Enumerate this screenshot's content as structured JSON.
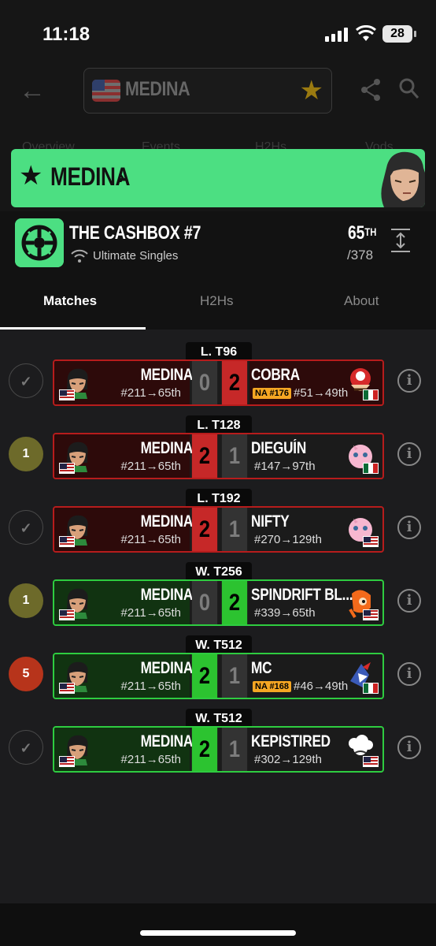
{
  "status": {
    "time": "11:18",
    "battery": "28"
  },
  "header": {
    "search_name": "MEDINA",
    "bg_tabs": [
      "Overview",
      "Events",
      "H2Hs",
      "Vods"
    ]
  },
  "banner": {
    "player": "MEDINA"
  },
  "event": {
    "name": "THE CASHBOX #7",
    "type": "Ultimate Singles",
    "placement": "65",
    "placement_suffix": "TH",
    "entrants": "/378"
  },
  "tabs": [
    "Matches",
    "H2Hs",
    "About"
  ],
  "colors": {
    "accent": "#4cdf82",
    "loss": "#c62828",
    "win": "#2cc330"
  },
  "matches": [
    {
      "round": "L. T96",
      "badge": "✓",
      "left_name": "MEDINA",
      "left_seed": "#211→65th",
      "left_score": "0",
      "right_score": "2",
      "right_name": "COBRA",
      "right_tag": "NA #176",
      "right_seed": "#51→49th",
      "right_flag": "mx"
    },
    {
      "round": "L. T128",
      "badge": "1",
      "left_name": "MEDINA",
      "left_seed": "#211→65th",
      "left_score": "2",
      "right_score": "1",
      "right_name": "DIEGUÍN",
      "right_tag": "",
      "right_seed": "#147→97th",
      "right_flag": "mx"
    },
    {
      "round": "L. T192",
      "badge": "✓",
      "left_name": "MEDINA",
      "left_seed": "#211→65th",
      "left_score": "2",
      "right_score": "1",
      "right_name": "NIFTY",
      "right_tag": "",
      "right_seed": "#270→129th",
      "right_flag": "us"
    },
    {
      "round": "W. T256",
      "badge": "1",
      "left_name": "MEDINA",
      "left_seed": "#211→65th",
      "left_score": "0",
      "right_score": "2",
      "right_name": "SPINDRIFT BL...",
      "right_tag": "",
      "right_seed": "#339→65th",
      "right_flag": "us"
    },
    {
      "round": "W. T512",
      "badge": "5",
      "left_name": "MEDINA",
      "left_seed": "#211→65th",
      "left_score": "2",
      "right_score": "1",
      "right_name": "MC",
      "right_tag": "NA #168",
      "right_seed": "#46→49th",
      "right_flag": "mx"
    },
    {
      "round": "W. T512",
      "badge": "✓",
      "left_name": "MEDINA",
      "left_seed": "#211→65th",
      "left_score": "2",
      "right_score": "1",
      "right_name": "KEPISTIRED",
      "right_tag": "",
      "right_seed": "#302→129th",
      "right_flag": "us"
    }
  ]
}
